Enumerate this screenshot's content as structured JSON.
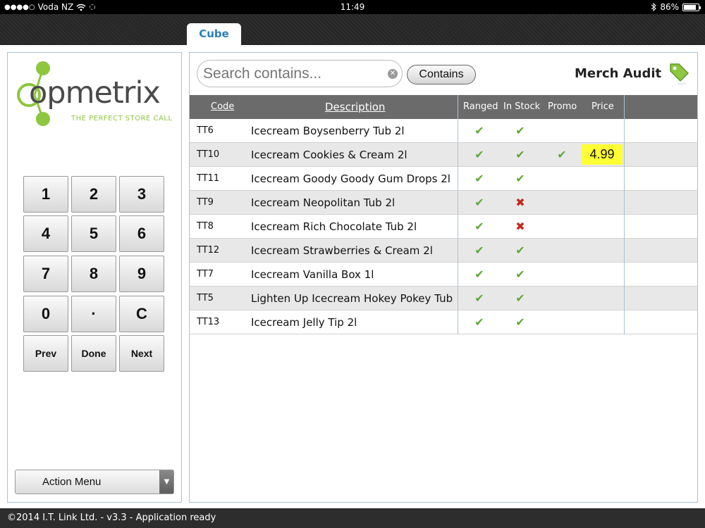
{
  "status_bar": {
    "signal": "●●●●○",
    "carrier": "Voda NZ",
    "wifi_icon": "wifi-icon",
    "time": "11:49",
    "bluetooth_icon": "bluetooth-icon",
    "battery_percent": "86%",
    "battery_level": 0.86
  },
  "tabs": [
    {
      "label": "Cube",
      "active": true
    }
  ],
  "logo": {
    "wordmark": "opmetrix",
    "tagline": "THE PERFECT STORE CALL",
    "accent_color": "#8dc63f"
  },
  "keypad": {
    "keys": [
      "1",
      "2",
      "3",
      "4",
      "5",
      "6",
      "7",
      "8",
      "9",
      "0",
      "·",
      "C"
    ],
    "prev": "Prev",
    "done": "Done",
    "next": "Next"
  },
  "action_menu": {
    "label": "Action Menu"
  },
  "search": {
    "placeholder": "Search contains...",
    "value": "",
    "mode_button": "Contains"
  },
  "header_title": "Merch Audit",
  "grid": {
    "columns": [
      "Code",
      "Description",
      "Ranged",
      "In Stock",
      "Promo",
      "Price"
    ],
    "rows": [
      {
        "code": "TT6",
        "description": "Icecream Boysenberry Tub 2l",
        "ranged": "✔",
        "in_stock": "✔",
        "promo": "",
        "price": ""
      },
      {
        "code": "TT10",
        "description": "Icecream Cookies & Cream 2l",
        "ranged": "✔",
        "in_stock": "✔",
        "promo": "✔",
        "price": "4.99"
      },
      {
        "code": "TT11",
        "description": "Icecream Goody Goody Gum Drops 2l",
        "ranged": "✔",
        "in_stock": "✔",
        "promo": "",
        "price": ""
      },
      {
        "code": "TT9",
        "description": "Icecream Neopolitan Tub 2l",
        "ranged": "✔",
        "in_stock": "✖",
        "promo": "",
        "price": ""
      },
      {
        "code": "TT8",
        "description": "Icecream Rich Chocolate Tub 2l",
        "ranged": "✔",
        "in_stock": "✖",
        "promo": "",
        "price": ""
      },
      {
        "code": "TT12",
        "description": "Icecream Strawberries & Cream 2l",
        "ranged": "✔",
        "in_stock": "✔",
        "promo": "",
        "price": ""
      },
      {
        "code": "TT7",
        "description": "Icecream Vanilla Box 1l",
        "ranged": "✔",
        "in_stock": "✔",
        "promo": "",
        "price": ""
      },
      {
        "code": "TT5",
        "description": "Lighten Up Icecream Hokey Pokey Tub",
        "ranged": "✔",
        "in_stock": "✔",
        "promo": "",
        "price": ""
      },
      {
        "code": "TT13",
        "description": "Icecream Jelly Tip 2l",
        "ranged": "✔",
        "in_stock": "✔",
        "promo": "",
        "price": ""
      }
    ]
  },
  "colors": {
    "check": "#5fa83a",
    "cross": "#c0271f",
    "price_highlight": "#ffff33",
    "tab_text": "#2a7fb8"
  },
  "footer": {
    "text": "©2014 I.T. Link Ltd. - v3.3 - Application ready"
  }
}
